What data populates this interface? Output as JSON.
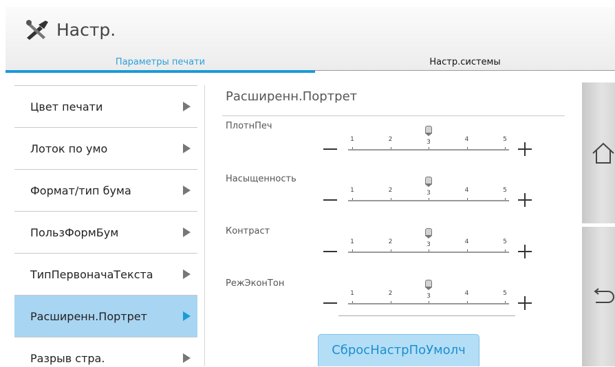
{
  "header": {
    "title": "Настр.",
    "icon": "tools-icon"
  },
  "tabs": [
    {
      "label": "Параметры печати",
      "active": true
    },
    {
      "label": "Настр.системы",
      "active": false
    }
  ],
  "menu": {
    "items": [
      {
        "label": "Цвет печати"
      },
      {
        "label": "Лоток по умо"
      },
      {
        "label": "Формат/тип бума"
      },
      {
        "label": "ПользФормБум"
      },
      {
        "label": "ТипПервоначаТекста"
      },
      {
        "label": "Расширенн.Портрет",
        "active": true
      },
      {
        "label": "Разрыв стра."
      }
    ]
  },
  "content": {
    "title": "Расширенн.Портрет",
    "scale_labels": [
      "1",
      "2",
      "3",
      "4",
      "5"
    ],
    "sliders": [
      {
        "label": "ПлотнПеч",
        "value": 3
      },
      {
        "label": "Насыщенность",
        "value": 3
      },
      {
        "label": "Контраст",
        "value": 3
      },
      {
        "label": "РежЭконТон",
        "value": 3
      }
    ],
    "reset_label": "СбросНастрПоУмолч"
  },
  "side": {
    "home_icon": "home-icon",
    "back_icon": "back-icon"
  },
  "colors": {
    "accent": "#1c9ad8",
    "active_bg": "#a8d5f2",
    "button_bg": "#b4def6"
  }
}
